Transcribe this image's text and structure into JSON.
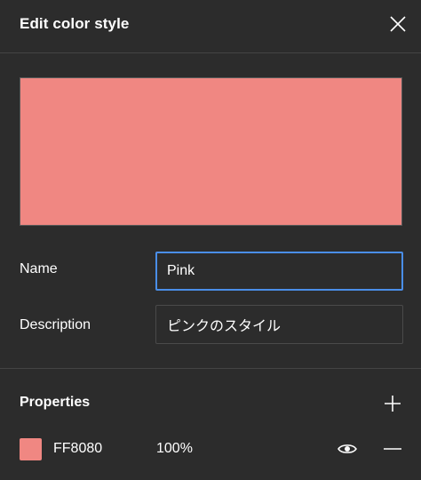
{
  "dialog": {
    "title": "Edit color style",
    "close_icon": "close-icon"
  },
  "preview": {
    "color": "#F08782"
  },
  "form": {
    "name_label": "Name",
    "name_value": "Pink",
    "description_label": "Description",
    "description_value": "ピンクのスタイル"
  },
  "properties": {
    "title": "Properties",
    "add_icon": "plus-icon",
    "items": [
      {
        "swatch_color": "#F08782",
        "hex": "FF8080",
        "opacity": "100%",
        "visibility_icon": "eye-icon",
        "remove_icon": "minus-icon"
      }
    ]
  },
  "colors": {
    "background": "#2C2C2C",
    "focus_border": "#4A8EE8",
    "divider": "#444444"
  }
}
